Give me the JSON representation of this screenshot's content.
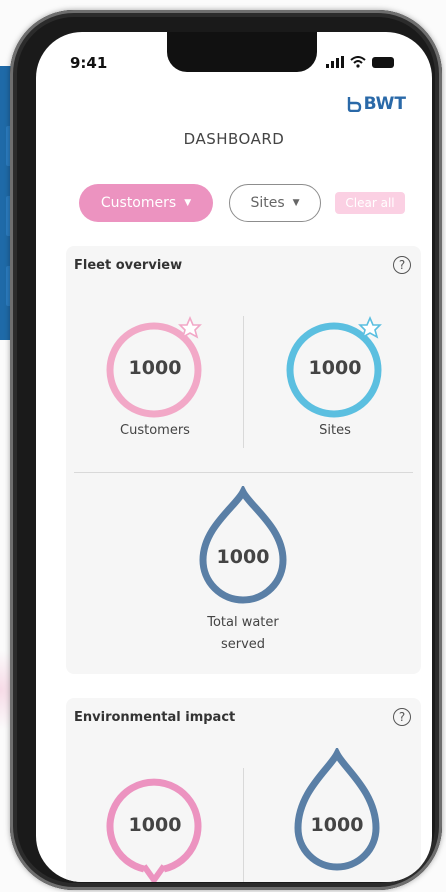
{
  "status_bar": {
    "time": "9:41"
  },
  "brand": {
    "logo_text": "BWT",
    "color": "#2a69a8"
  },
  "header": {
    "title": "DASHBOARD"
  },
  "filters": {
    "customers_label": "Customers",
    "sites_label": "Sites",
    "clear_label": "Clear all"
  },
  "fleet_overview": {
    "title": "Fleet overview",
    "customers": {
      "value": "1000",
      "label": "Customers",
      "color": "#f2a8c7"
    },
    "sites": {
      "value": "1000",
      "label": "Sites",
      "color": "#5bbfe0"
    },
    "water": {
      "value": "1000",
      "label_line1": "Total water",
      "label_line2": "served",
      "color": "#5a7fa6"
    }
  },
  "environmental_impact": {
    "title": "Environmental impact",
    "left": {
      "value": "1000",
      "color": "#ec93c0"
    },
    "right": {
      "value": "1000",
      "color": "#5a7fa6"
    }
  }
}
